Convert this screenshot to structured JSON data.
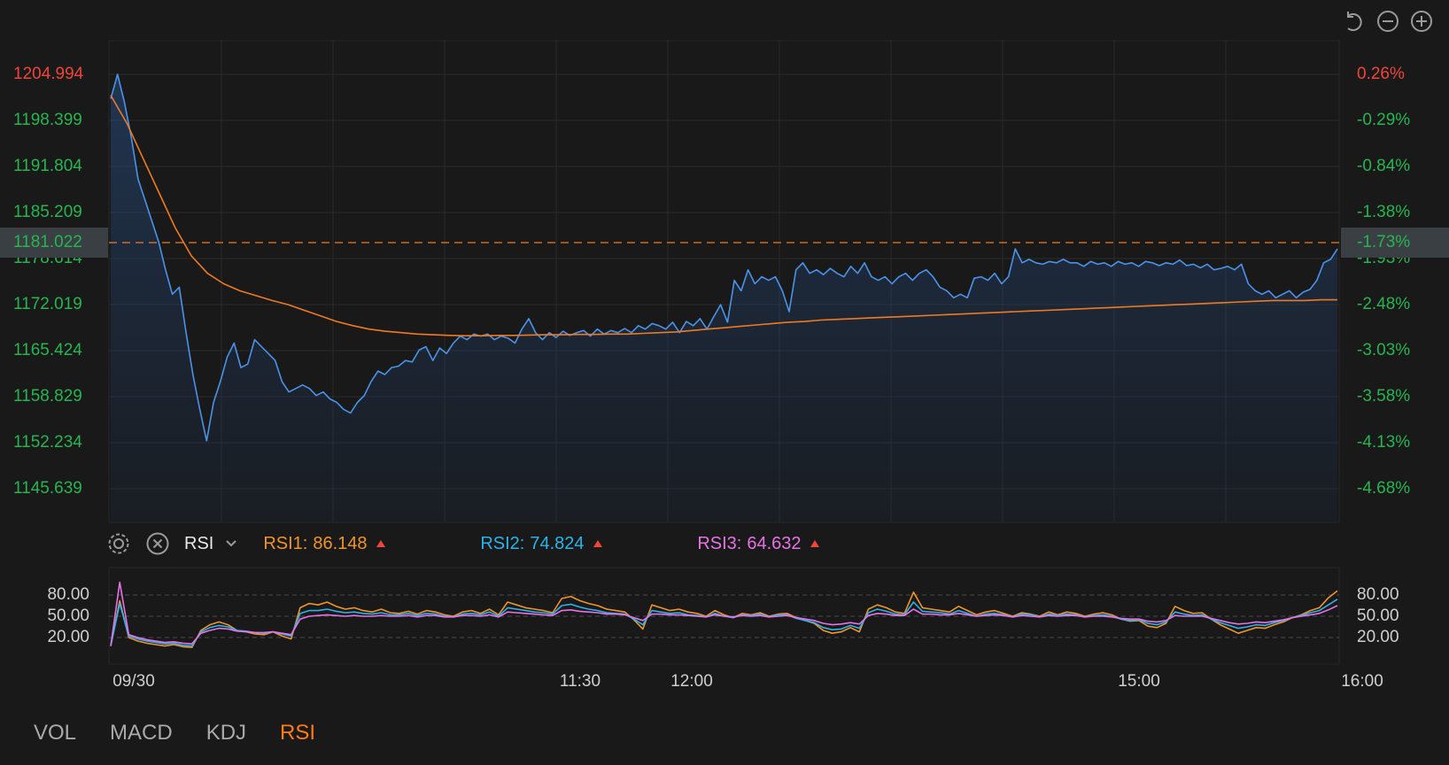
{
  "toolbar": {
    "icons": [
      "undo-icon",
      "zoom-out-icon",
      "zoom-in-icon"
    ]
  },
  "colors": {
    "price_line": "#4a93e8",
    "avg_line": "#ef7a22",
    "up": "#f0453a",
    "down": "#27b54f",
    "rsi1": "#f0942a",
    "rsi2": "#2bb3ea",
    "rsi3": "#e573e6",
    "grid": "#2b2b2b"
  },
  "crosshair": {
    "price": "1181.022",
    "percent": "-1.73%"
  },
  "indicator": {
    "name": "RSI",
    "rsi1_label": "RSI1:",
    "rsi1_value": "86.148",
    "rsi2_label": "RSI2:",
    "rsi2_value": "74.824",
    "rsi3_label": "RSI3:",
    "rsi3_value": "64.632"
  },
  "tabs": [
    "VOL",
    "MACD",
    "KDJ",
    "RSI"
  ],
  "active_tab": "RSI",
  "chart_data": [
    {
      "type": "line",
      "y_ticks": [
        "1204.994",
        "1198.399",
        "1191.804",
        "1185.209",
        "1178.614",
        "1172.019",
        "1165.424",
        "1158.829",
        "1152.234",
        "1145.639"
      ],
      "pct_ticks": [
        "0.26%",
        "-0.29%",
        "-0.84%",
        "-1.38%",
        "-1.93%",
        "-2.48%",
        "-3.03%",
        "-3.58%",
        "-4.13%",
        "-4.68%"
      ],
      "ylim": [
        1145.639,
        1204.994
      ],
      "x_ticks": [
        "09/30",
        "11:30",
        "12:00",
        "15:00",
        "16:00"
      ],
      "series": [
        {
          "values": [
            1201.5,
            1205.0,
            1201.0,
            1196.0,
            1190.0,
            1187.0,
            1184.0,
            1181.0,
            1177.0,
            1173.5,
            1174.5,
            1168.0,
            1162.0,
            1157.0,
            1152.5,
            1158.0,
            1161.0,
            1164.5,
            1166.5,
            1163.0,
            1163.5,
            1167.0,
            1166.0,
            1165.0,
            1164.0,
            1161.0,
            1159.5,
            1160.0,
            1160.5,
            1160.0,
            1159.0,
            1159.5,
            1158.5,
            1158.0,
            1157.0,
            1156.5,
            1158.0,
            1159.0,
            1161.0,
            1162.5,
            1162.0,
            1163.0,
            1163.2,
            1164.0,
            1163.8,
            1165.5,
            1166.0,
            1164.0,
            1165.8,
            1165.0,
            1166.5,
            1167.5,
            1167.0,
            1167.8,
            1167.5,
            1167.8,
            1167.0,
            1167.5,
            1167.2,
            1166.5,
            1168.5,
            1170.0,
            1168.0,
            1167.0,
            1168.0,
            1167.3,
            1168.2,
            1167.6,
            1168.0,
            1168.3,
            1167.5,
            1168.5,
            1167.8,
            1168.3,
            1168.0,
            1168.6,
            1168.0,
            1169.0,
            1168.5,
            1169.3,
            1169.0,
            1168.5,
            1169.5,
            1168.0,
            1169.6,
            1169.0,
            1170.0,
            1168.5,
            1170.3,
            1172.0,
            1169.5,
            1175.5,
            1174.0,
            1177.0,
            1175.0,
            1176.0,
            1175.5,
            1176.0,
            1174.0,
            1171.0,
            1177.0,
            1178.0,
            1176.5,
            1177.0,
            1176.3,
            1177.2,
            1176.5,
            1176.0,
            1177.5,
            1176.5,
            1178.0,
            1176.0,
            1175.5,
            1176.0,
            1175.0,
            1176.0,
            1176.5,
            1175.5,
            1176.5,
            1177.0,
            1176.0,
            1174.5,
            1174.0,
            1173.0,
            1173.5,
            1173.0,
            1175.8,
            1176.0,
            1175.5,
            1176.5,
            1175.0,
            1176.0,
            1180.0,
            1178.0,
            1178.5,
            1178.0,
            1177.8,
            1178.2,
            1178.0,
            1178.5,
            1178.0,
            1178.0,
            1177.5,
            1178.2,
            1177.8,
            1178.0,
            1177.5,
            1178.2,
            1177.8,
            1178.0,
            1177.5,
            1178.2,
            1178.0,
            1177.6,
            1178.0,
            1177.8,
            1178.4,
            1177.6,
            1177.8,
            1177.3,
            1177.8,
            1177.0,
            1177.2,
            1177.5,
            1177.0,
            1177.8,
            1175.0,
            1174.0,
            1173.5,
            1174.0,
            1173.0,
            1173.5,
            1174.0,
            1173.0,
            1173.8,
            1174.2,
            1175.5,
            1178.0,
            1178.5,
            1180.0
          ],
          "color": "#4a93e8"
        },
        {
          "values": [
            1202.0,
            1198.0,
            1193.0,
            1188.0,
            1183.0,
            1179.0,
            1176.5,
            1175.0,
            1174.0,
            1173.3,
            1172.6,
            1172.0,
            1171.2,
            1170.4,
            1169.6,
            1169.0,
            1168.5,
            1168.2,
            1168.0,
            1167.8,
            1167.7,
            1167.6,
            1167.55,
            1167.55,
            1167.6,
            1167.6,
            1167.65,
            1167.7,
            1167.7,
            1167.75,
            1167.75,
            1167.8,
            1167.8,
            1167.9,
            1168.0,
            1168.1,
            1168.3,
            1168.5,
            1168.7,
            1168.9,
            1169.1,
            1169.3,
            1169.5,
            1169.6,
            1169.8,
            1169.9,
            1170.0,
            1170.1,
            1170.2,
            1170.3,
            1170.4,
            1170.5,
            1170.6,
            1170.7,
            1170.8,
            1170.9,
            1171.0,
            1171.1,
            1171.2,
            1171.3,
            1171.4,
            1171.5,
            1171.6,
            1171.7,
            1171.8,
            1171.9,
            1172.0,
            1172.1,
            1172.2,
            1172.3,
            1172.4,
            1172.5,
            1172.6,
            1172.6,
            1172.6,
            1172.7,
            1172.7
          ],
          "color": "#ef7a22"
        }
      ]
    },
    {
      "type": "line",
      "y_ticks": [
        "80.00",
        "50.00",
        "20.00"
      ],
      "ylim": [
        0,
        105
      ],
      "series": [
        {
          "name": "RSI1",
          "values": [
            8,
            72,
            20,
            15,
            12,
            10,
            8,
            10,
            7,
            6,
            30,
            38,
            42,
            38,
            30,
            28,
            25,
            24,
            28,
            22,
            18,
            62,
            68,
            66,
            70,
            64,
            60,
            62,
            58,
            56,
            60,
            55,
            54,
            57,
            53,
            58,
            56,
            52,
            50,
            56,
            58,
            54,
            60,
            52,
            70,
            66,
            62,
            60,
            58,
            55,
            75,
            78,
            72,
            68,
            65,
            60,
            58,
            56,
            45,
            32,
            66,
            62,
            58,
            60,
            56,
            54,
            50,
            58,
            52,
            48,
            54,
            52,
            55,
            50,
            53,
            54,
            48,
            44,
            40,
            30,
            26,
            28,
            34,
            28,
            60,
            66,
            62,
            56,
            54,
            84,
            62,
            60,
            58,
            56,
            64,
            58,
            52,
            56,
            58,
            54,
            50,
            55,
            53,
            50,
            56,
            52,
            56,
            54,
            50,
            53,
            55,
            52,
            46,
            43,
            44,
            36,
            34,
            40,
            64,
            58,
            54,
            55,
            46,
            38,
            32,
            26,
            30,
            34,
            33,
            38,
            42,
            48,
            52,
            58,
            62,
            76,
            86
          ],
          "color": "#f0942a"
        },
        {
          "name": "RSI2",
          "values": [
            8,
            68,
            22,
            18,
            15,
            13,
            11,
            12,
            9,
            8,
            28,
            34,
            37,
            35,
            30,
            29,
            27,
            26,
            28,
            25,
            22,
            54,
            58,
            58,
            60,
            57,
            55,
            56,
            54,
            53,
            55,
            52,
            52,
            54,
            51,
            54,
            53,
            50,
            49,
            53,
            54,
            52,
            56,
            50,
            62,
            60,
            58,
            56,
            55,
            53,
            65,
            67,
            63,
            60,
            58,
            55,
            54,
            53,
            46,
            38,
            58,
            56,
            54,
            55,
            52,
            51,
            49,
            54,
            50,
            48,
            52,
            51,
            53,
            49,
            52,
            52,
            47,
            44,
            41,
            34,
            31,
            32,
            37,
            33,
            55,
            60,
            57,
            53,
            52,
            70,
            57,
            56,
            55,
            53,
            58,
            54,
            50,
            53,
            54,
            52,
            49,
            53,
            52,
            49,
            53,
            51,
            53,
            52,
            49,
            51,
            52,
            50,
            46,
            44,
            45,
            40,
            38,
            42,
            56,
            53,
            51,
            52,
            46,
            41,
            37,
            33,
            35,
            38,
            37,
            41,
            44,
            48,
            51,
            55,
            58,
            66,
            74
          ],
          "color": "#2bb3ea"
        },
        {
          "name": "RSI3",
          "values": [
            8,
            98,
            24,
            20,
            17,
            15,
            13,
            14,
            12,
            11,
            26,
            30,
            33,
            32,
            29,
            28,
            27,
            27,
            28,
            26,
            24,
            46,
            50,
            51,
            52,
            51,
            50,
            51,
            50,
            50,
            51,
            50,
            50,
            51,
            49,
            51,
            51,
            49,
            49,
            51,
            51,
            50,
            52,
            49,
            56,
            55,
            54,
            53,
            52,
            51,
            58,
            59,
            57,
            56,
            55,
            53,
            53,
            52,
            48,
            44,
            53,
            53,
            52,
            52,
            51,
            50,
            49,
            52,
            50,
            49,
            51,
            50,
            51,
            49,
            50,
            51,
            48,
            46,
            44,
            40,
            38,
            39,
            41,
            39,
            51,
            54,
            53,
            51,
            51,
            60,
            53,
            53,
            52,
            52,
            54,
            52,
            50,
            51,
            52,
            51,
            49,
            51,
            50,
            49,
            51,
            50,
            51,
            51,
            49,
            50,
            50,
            49,
            47,
            46,
            46,
            43,
            42,
            44,
            51,
            50,
            50,
            50,
            47,
            44,
            41,
            39,
            40,
            42,
            41,
            43,
            45,
            48,
            50,
            52,
            54,
            59,
            65
          ],
          "color": "#e573e6"
        }
      ]
    }
  ]
}
